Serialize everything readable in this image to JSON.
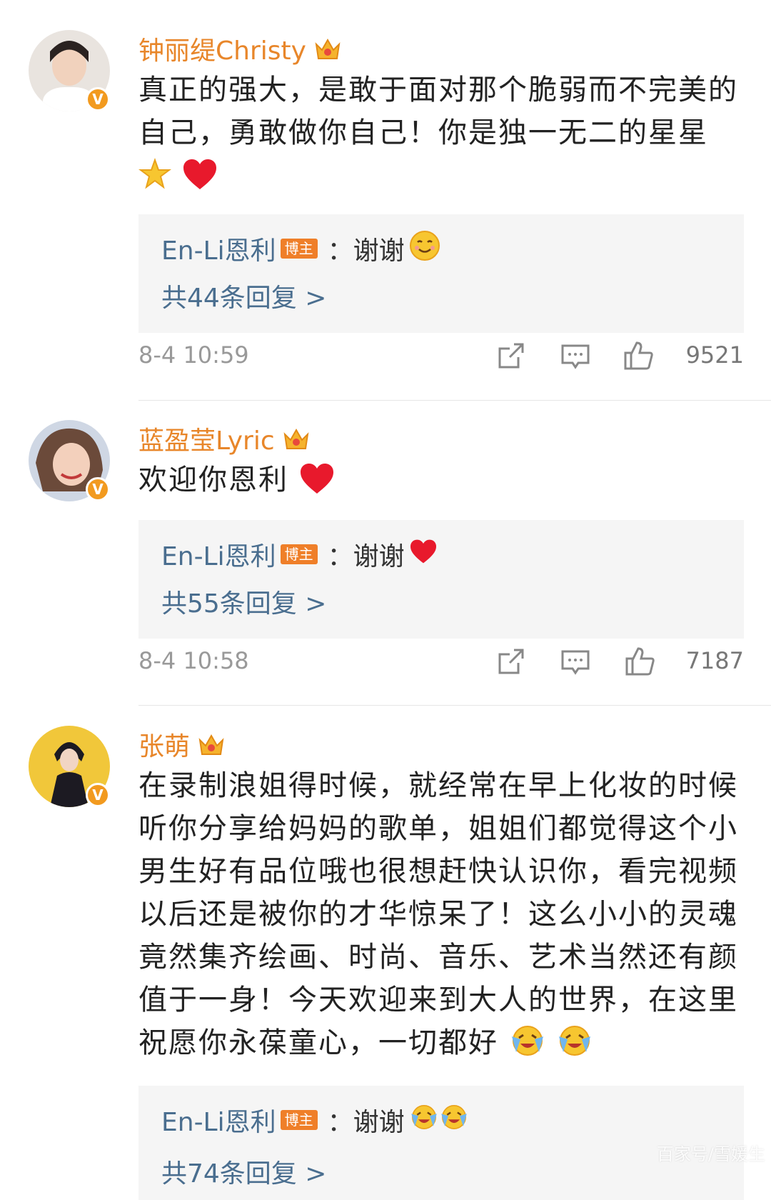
{
  "comments": [
    {
      "author": "钟丽缇Christy",
      "text": "真正的强大，是敢于面对那个脆弱而不完美的自己，勇敢做你自己！你是独一无二的星星",
      "reply": {
        "author": "En-Li恩利",
        "badge": "博主",
        "text": "：谢谢",
        "count": "共44条回复 >"
      },
      "time": "8-4 10:59",
      "likes": "9521"
    },
    {
      "author": "蓝盈莹Lyric",
      "text": "欢迎你恩利",
      "reply": {
        "author": "En-Li恩利",
        "badge": "博主",
        "text": "：谢谢",
        "count": "共55条回复 >"
      },
      "time": "8-4 10:58",
      "likes": "7187"
    },
    {
      "author": "张萌",
      "text": "在录制浪姐得时候，就经常在早上化妆的时候听你分享给妈妈的歌单，姐姐们都觉得这个小男生好有品位哦也很想赶快认识你，看完视频以后还是被你的才华惊呆了！这么小小的灵魂竟然集齐绘画、时尚、音乐、艺术当然还有颜值于一身！今天欢迎来到大人的世界，在这里祝愿你永葆童心，一切都好",
      "reply": {
        "author": "En-Li恩利",
        "badge": "博主",
        "text": "：谢谢",
        "count": "共74条回复 >"
      }
    }
  ],
  "verified_badge": "V",
  "watermark": "百家号/雪媛生",
  "colors": {
    "author": "#e8862a",
    "link": "#4a6e8f",
    "badge": "#ef7f29",
    "reply_bg": "#f5f5f5"
  }
}
